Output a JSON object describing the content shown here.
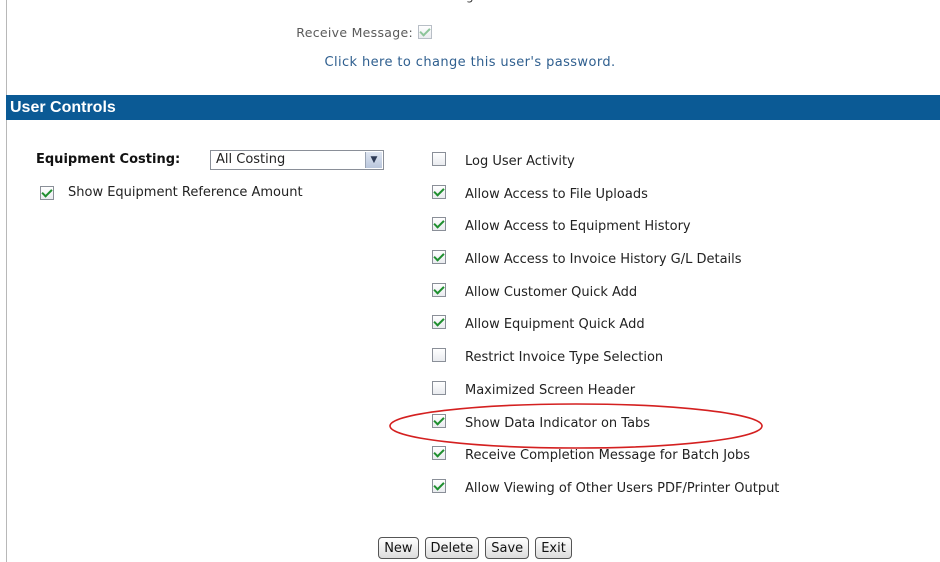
{
  "top_fragment": "g",
  "receive_message": {
    "label": "Receive Message:",
    "checked": true
  },
  "password_link": "Click here to change this user's password.",
  "section": {
    "title": "User Controls"
  },
  "equipment_costing": {
    "label": "Equipment Costing:",
    "selected": "All Costing"
  },
  "show_reference": {
    "label": "Show Equipment Reference Amount",
    "checked": true
  },
  "options": [
    {
      "label": "Log User Activity",
      "checked": false
    },
    {
      "label": "Allow Access to File Uploads",
      "checked": true
    },
    {
      "label": "Allow Access to Equipment History",
      "checked": true
    },
    {
      "label": "Allow Access to Invoice History G/L Details",
      "checked": true
    },
    {
      "label": "Allow Customer Quick Add",
      "checked": true
    },
    {
      "label": "Allow Equipment Quick Add",
      "checked": true
    },
    {
      "label": "Restrict Invoice Type Selection",
      "checked": false
    },
    {
      "label": "Maximized Screen Header",
      "checked": false
    },
    {
      "label": "Show Data Indicator on Tabs",
      "checked": true
    },
    {
      "label": "Receive Completion Message for Batch Jobs",
      "checked": true
    },
    {
      "label": "Allow Viewing of Other Users PDF/Printer Output",
      "checked": true
    }
  ],
  "buttons": {
    "new": "New",
    "delete": "Delete",
    "save": "Save",
    "exit": "Exit"
  },
  "colors": {
    "header_bg": "#0b5a95",
    "link": "#2f5f8f",
    "check": "#1f8f2f",
    "highlight": "#d42020"
  }
}
